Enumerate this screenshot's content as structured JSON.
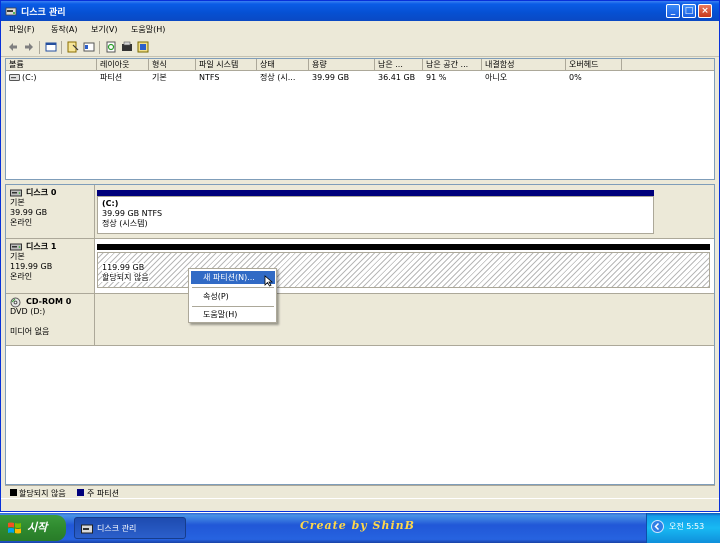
{
  "window": {
    "title": "디스크 관리",
    "controls": {
      "minimize": "_",
      "maximize": "□",
      "close": "×"
    }
  },
  "menubar": [
    {
      "label": "파일(F)"
    },
    {
      "label": "동작(A)"
    },
    {
      "label": "보기(V)"
    },
    {
      "label": "도움말(H)"
    }
  ],
  "toolbar": {
    "icons": [
      "back-icon",
      "forward-icon",
      "console-icon",
      "properties-icon",
      "list-icon",
      "refresh-icon",
      "rescan-icon",
      "help-icon"
    ]
  },
  "volume_list": {
    "columns": [
      "볼륨",
      "레이아웃",
      "형식",
      "파일 시스템",
      "상태",
      "용량",
      "남은 ...",
      "남은 공간 ...",
      "내결함성",
      "오버헤드"
    ],
    "rows": [
      [
        "(C:)",
        "파티션",
        "기본",
        "NTFS",
        "정상 (시...",
        "39.99 GB",
        "36.41 GB",
        "91 %",
        "아니오",
        "0%"
      ]
    ]
  },
  "disks": [
    {
      "name": "디스크 0",
      "type": "기본",
      "size": "39.99 GB",
      "status": "온라인",
      "partition": {
        "label": "(C:)",
        "size_fs": "39.99 GB NTFS",
        "status": "정상 (시스템)"
      }
    },
    {
      "name": "디스크 1",
      "type": "기본",
      "size": "119.99 GB",
      "status": "온라인",
      "partition": {
        "size": "119.99 GB",
        "status": "할당되지 않음"
      }
    },
    {
      "name": "CD-ROM 0",
      "type": "DVD (D:)",
      "status": "미디어 없음"
    }
  ],
  "context_menu": {
    "items": [
      {
        "label": "새 파티션(N)..."
      },
      {
        "label": "속성(P)"
      },
      {
        "label": "도움말(H)"
      }
    ]
  },
  "legend": [
    {
      "label": "할당되지 않음",
      "color": "#000000"
    },
    {
      "label": "주 파티션",
      "color": "#00007b"
    }
  ],
  "taskbar": {
    "start_label": "시작",
    "task_label": "디스크 관리",
    "brand": "Create by ShinB",
    "clock": "오전 5:53"
  },
  "colors": {
    "titlebar": "#0a5ce6",
    "primary_partition": "#00007b",
    "unallocated": "#000000",
    "menu_highlight": "#316ac5",
    "taskbar": "#2157d7",
    "start_button": "#2f8a2f"
  }
}
